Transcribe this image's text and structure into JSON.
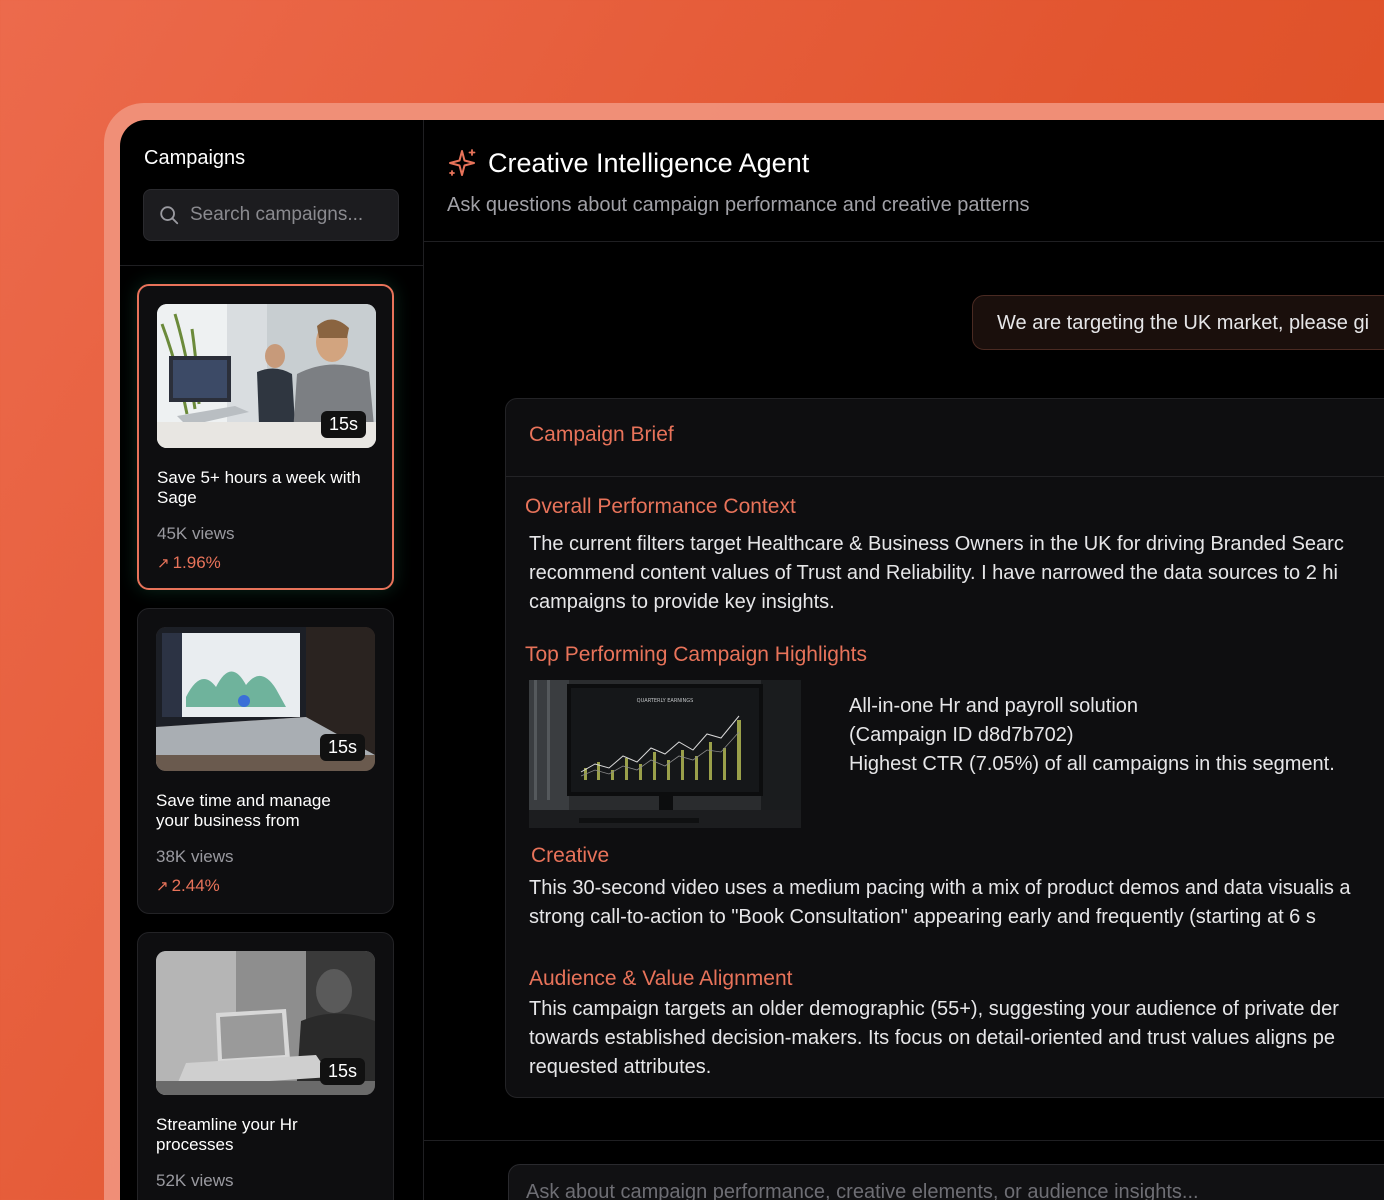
{
  "sidebar": {
    "title": "Campaigns",
    "search": {
      "placeholder": "Search campaigns..."
    },
    "campaigns": [
      {
        "duration": "15s",
        "title": "Save 5+ hours a week with Sage",
        "views": "45K views",
        "ctr": "1.96%",
        "active": true
      },
      {
        "duration": "15s",
        "title": "Save time and manage your business from",
        "views": "38K views",
        "ctr": "2.44%",
        "active": false
      },
      {
        "duration": "15s",
        "title": "Streamline your Hr processes",
        "views": "52K views",
        "ctr": "",
        "active": false
      }
    ]
  },
  "agent": {
    "title": "Creative Intelligence Agent",
    "subtitle": "Ask questions about campaign performance and creative patterns"
  },
  "chat": {
    "user_message": "We are targeting the UK market, please gi"
  },
  "brief": {
    "title": "Campaign Brief",
    "overall_heading": "Overall Performance Context",
    "overall_text": "The current filters target Healthcare & Business Owners in the UK for driving Branded Searc recommend content values of Trust and Reliability. I have narrowed the data sources to 2 hi campaigns to provide key insights.",
    "top_heading": "Top Performing Campaign Highlights",
    "highlight_line1": "All-in-one Hr and payroll solution",
    "highlight_line2": "(Campaign ID d8d7b702)",
    "highlight_line3": "Highest CTR (7.05%) of all campaigns in this segment.",
    "creative_heading": "Creative",
    "creative_text": "This 30-second video uses a medium pacing with a mix of product demos and data visualis a strong call-to-action to \"Book Consultation\" appearing early and frequently (starting at 6 s",
    "audience_heading": "Audience & Value Alignment",
    "audience_text": "This campaign targets an older demographic (55+), suggesting your audience of private der towards established decision-makers. Its focus on detail-oriented and trust values aligns pe requested attributes."
  },
  "composer": {
    "placeholder": "Ask about campaign performance, creative elements, or audience insights..."
  },
  "colors": {
    "accent": "#e8735a",
    "background": "#000000",
    "panel": "#0e0e10"
  }
}
